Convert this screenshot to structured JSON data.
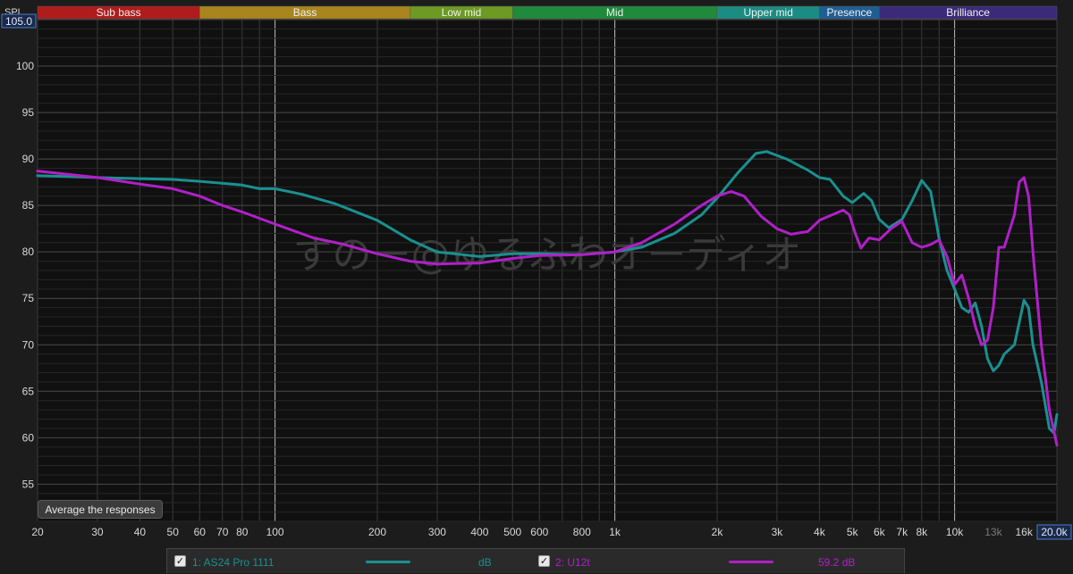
{
  "axis": {
    "y_label": "SPL",
    "y_max_box": "105.0",
    "x_max_box": "20.0k"
  },
  "bands": [
    {
      "label": "Sub bass",
      "from": 20,
      "to": 60,
      "color": "#b01b1b"
    },
    {
      "label": "Bass",
      "from": 60,
      "to": 250,
      "color": "#a8861d"
    },
    {
      "label": "Low mid",
      "from": 250,
      "to": 500,
      "color": "#6c9a22"
    },
    {
      "label": "Mid",
      "from": 500,
      "to": 2000,
      "color": "#1f8a3b"
    },
    {
      "label": "Upper mid",
      "from": 2000,
      "to": 4000,
      "color": "#1b8c84"
    },
    {
      "label": "Presence",
      "from": 4000,
      "to": 6000,
      "color": "#1f5e93"
    },
    {
      "label": "Brilliance",
      "from": 6000,
      "to": 20000,
      "color": "#3b2a7a"
    }
  ],
  "watermark": "すのー@ゆるふわオーディオ",
  "average_button": "Average the responses",
  "legend": [
    {
      "check": "✓",
      "name": "1: AS24 Pro 1111",
      "value": "dB",
      "color": "#1a9090"
    },
    {
      "check": "✓",
      "name": "2: U12t",
      "value": "59.2 dB",
      "color": "#b020c8"
    }
  ],
  "chart_data": {
    "type": "line",
    "x_scale": "log",
    "xlim": [
      20,
      20000
    ],
    "ylim": [
      51,
      105
    ],
    "grid": true,
    "ylabel": "SPL",
    "x_ticks": [
      {
        "v": 20,
        "t": "20"
      },
      {
        "v": 30,
        "t": "30"
      },
      {
        "v": 40,
        "t": "40"
      },
      {
        "v": 50,
        "t": "50"
      },
      {
        "v": 60,
        "t": "60"
      },
      {
        "v": 70,
        "t": "70"
      },
      {
        "v": 80,
        "t": "80"
      },
      {
        "v": 100,
        "t": "100"
      },
      {
        "v": 200,
        "t": "200"
      },
      {
        "v": 300,
        "t": "300"
      },
      {
        "v": 400,
        "t": "400"
      },
      {
        "v": 500,
        "t": "500"
      },
      {
        "v": 600,
        "t": "600"
      },
      {
        "v": 800,
        "t": "800"
      },
      {
        "v": 1000,
        "t": "1k"
      },
      {
        "v": 2000,
        "t": "2k"
      },
      {
        "v": 3000,
        "t": "3k"
      },
      {
        "v": 4000,
        "t": "4k"
      },
      {
        "v": 5000,
        "t": "5k"
      },
      {
        "v": 6000,
        "t": "6k"
      },
      {
        "v": 7000,
        "t": "7k"
      },
      {
        "v": 8000,
        "t": "8k"
      },
      {
        "v": 10000,
        "t": "10k"
      },
      {
        "v": 13000,
        "t": "13k",
        "dim": true
      },
      {
        "v": 16000,
        "t": "16k"
      }
    ],
    "y_ticks": [
      55,
      60,
      65,
      70,
      75,
      80,
      85,
      90,
      95,
      100
    ],
    "series": [
      {
        "name": "1: AS24 Pro 1111",
        "color": "#1a9090",
        "points": [
          [
            20,
            88.2
          ],
          [
            30,
            88.0
          ],
          [
            50,
            87.8
          ],
          [
            60,
            87.6
          ],
          [
            80,
            87.2
          ],
          [
            90,
            86.8
          ],
          [
            100,
            86.8
          ],
          [
            120,
            86.2
          ],
          [
            150,
            85.2
          ],
          [
            200,
            83.4
          ],
          [
            250,
            81.3
          ],
          [
            300,
            80.0
          ],
          [
            400,
            79.5
          ],
          [
            500,
            79.8
          ],
          [
            600,
            79.8
          ],
          [
            800,
            79.7
          ],
          [
            1000,
            80.0
          ],
          [
            1200,
            80.5
          ],
          [
            1500,
            82.0
          ],
          [
            1800,
            84.0
          ],
          [
            2000,
            85.8
          ],
          [
            2300,
            88.5
          ],
          [
            2600,
            90.6
          ],
          [
            2800,
            90.8
          ],
          [
            3200,
            90.0
          ],
          [
            3700,
            88.8
          ],
          [
            4000,
            88.0
          ],
          [
            4300,
            87.8
          ],
          [
            4700,
            86.0
          ],
          [
            5000,
            85.3
          ],
          [
            5400,
            86.3
          ],
          [
            5700,
            85.5
          ],
          [
            6000,
            83.5
          ],
          [
            6400,
            82.6
          ],
          [
            7000,
            83.5
          ],
          [
            7500,
            85.5
          ],
          [
            8000,
            87.7
          ],
          [
            8500,
            86.5
          ],
          [
            9000,
            81.5
          ],
          [
            9500,
            78.0
          ],
          [
            10000,
            76.0
          ],
          [
            10500,
            74.0
          ],
          [
            11000,
            73.5
          ],
          [
            11500,
            74.5
          ],
          [
            12000,
            72.0
          ],
          [
            12500,
            68.5
          ],
          [
            13000,
            67.2
          ],
          [
            13500,
            67.8
          ],
          [
            14000,
            69.0
          ],
          [
            15000,
            70.0
          ],
          [
            16000,
            74.8
          ],
          [
            16500,
            74.0
          ],
          [
            17000,
            70.0
          ],
          [
            18000,
            66.0
          ],
          [
            19000,
            61.0
          ],
          [
            19600,
            60.5
          ],
          [
            20000,
            62.5
          ]
        ]
      },
      {
        "name": "2: U12t",
        "color": "#b020c8",
        "points": [
          [
            20,
            88.7
          ],
          [
            30,
            88.0
          ],
          [
            40,
            87.3
          ],
          [
            50,
            86.8
          ],
          [
            60,
            86.0
          ],
          [
            70,
            85.0
          ],
          [
            80,
            84.3
          ],
          [
            100,
            83.0
          ],
          [
            130,
            81.5
          ],
          [
            160,
            80.8
          ],
          [
            200,
            79.8
          ],
          [
            250,
            79.0
          ],
          [
            300,
            78.7
          ],
          [
            400,
            78.8
          ],
          [
            500,
            79.3
          ],
          [
            600,
            79.6
          ],
          [
            800,
            79.7
          ],
          [
            1000,
            80.0
          ],
          [
            1200,
            81.0
          ],
          [
            1500,
            83.0
          ],
          [
            1800,
            85.0
          ],
          [
            2000,
            86.0
          ],
          [
            2200,
            86.5
          ],
          [
            2400,
            86.0
          ],
          [
            2700,
            83.8
          ],
          [
            3000,
            82.5
          ],
          [
            3300,
            81.9
          ],
          [
            3700,
            82.2
          ],
          [
            4000,
            83.4
          ],
          [
            4300,
            83.9
          ],
          [
            4700,
            84.5
          ],
          [
            4900,
            84.0
          ],
          [
            5100,
            82.0
          ],
          [
            5300,
            80.4
          ],
          [
            5600,
            81.5
          ],
          [
            6000,
            81.3
          ],
          [
            6500,
            82.5
          ],
          [
            7000,
            83.3
          ],
          [
            7500,
            81.0
          ],
          [
            8000,
            80.5
          ],
          [
            8500,
            80.8
          ],
          [
            9000,
            81.3
          ],
          [
            9500,
            79.5
          ],
          [
            10000,
            76.5
          ],
          [
            10500,
            77.5
          ],
          [
            11000,
            75.0
          ],
          [
            11500,
            72.0
          ],
          [
            12000,
            70.0
          ],
          [
            12500,
            70.5
          ],
          [
            13000,
            74.0
          ],
          [
            13500,
            80.5
          ],
          [
            14000,
            80.5
          ],
          [
            15000,
            84.0
          ],
          [
            15500,
            87.5
          ],
          [
            16000,
            88.0
          ],
          [
            16500,
            86.0
          ],
          [
            17000,
            80.0
          ],
          [
            18000,
            70.0
          ],
          [
            19000,
            63.0
          ],
          [
            20000,
            59.2
          ]
        ]
      }
    ]
  }
}
